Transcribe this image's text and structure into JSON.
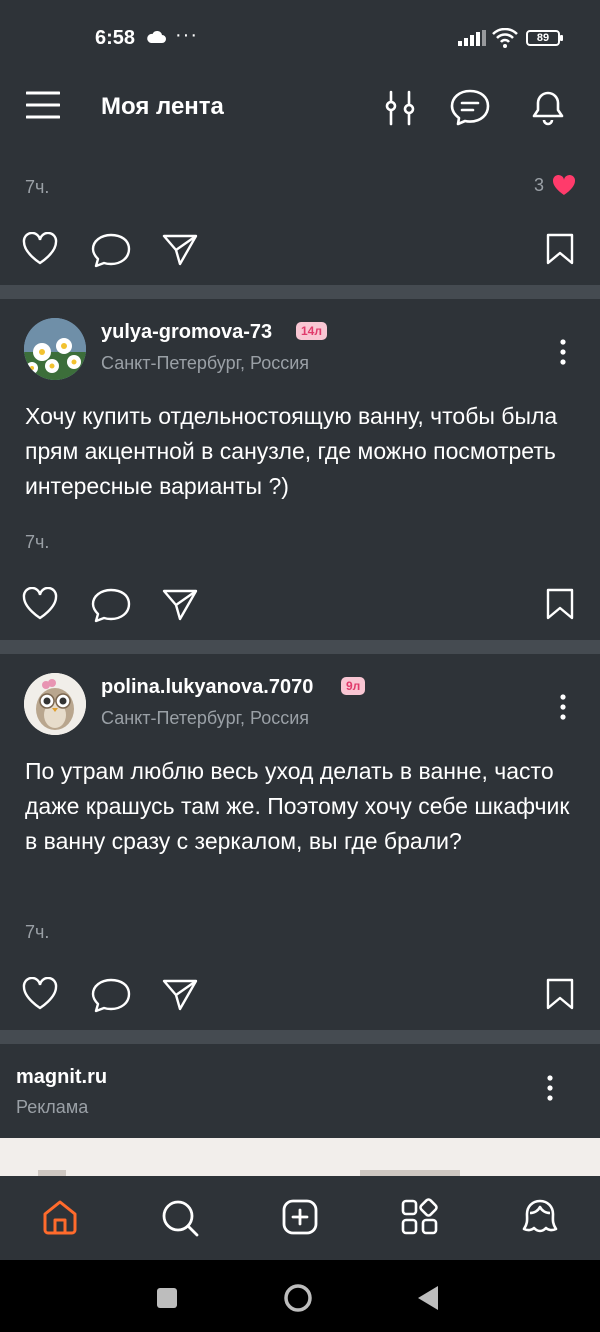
{
  "status": {
    "time": "6:58",
    "dots": "···",
    "battery": "89"
  },
  "appbar": {
    "title": "Моя лента"
  },
  "top_post": {
    "time": "7ч.",
    "likes": "3"
  },
  "posts": [
    {
      "username": "yulya-gromova-73",
      "age": "14л",
      "location": "Санкт-Петербург, Россия",
      "text": "Хочу купить отдельностоящую ванну, чтобы была прям акцентной в санузле, где можно посмотреть интересные варианты ?)",
      "time": "7ч."
    },
    {
      "username": "polina.lukyanova.7070",
      "age": "9л",
      "location": "Санкт-Петербург, Россия",
      "text": "По утрам люблю весь уход делать в ванне, часто даже крашусь там же. Поэтому хочу себе шкафчик в ванну сразу с зеркалом, вы где брали?",
      "time": "7ч."
    }
  ],
  "ad": {
    "title": "magnit.ru",
    "label": "Реклама"
  },
  "colors": {
    "background": "#2e3338",
    "divider": "#454b51",
    "accent": "#ff6b2c",
    "heart": "#ff3b6b",
    "muted": "#9aa0a6"
  },
  "icons": {
    "statusbar": [
      "cloud-icon",
      "signal-icon",
      "wifi-icon",
      "battery-icon"
    ],
    "appbar": [
      "menu-icon",
      "filter-icon",
      "chat-icon",
      "bell-icon"
    ],
    "post_actions": [
      "like-icon",
      "comment-icon",
      "share-icon",
      "bookmark-icon"
    ],
    "bottom_nav": [
      "home-icon",
      "search-icon",
      "add-icon",
      "services-icon",
      "profile-icon"
    ],
    "system_nav": [
      "recents-icon",
      "home-circle-icon",
      "back-icon"
    ]
  }
}
